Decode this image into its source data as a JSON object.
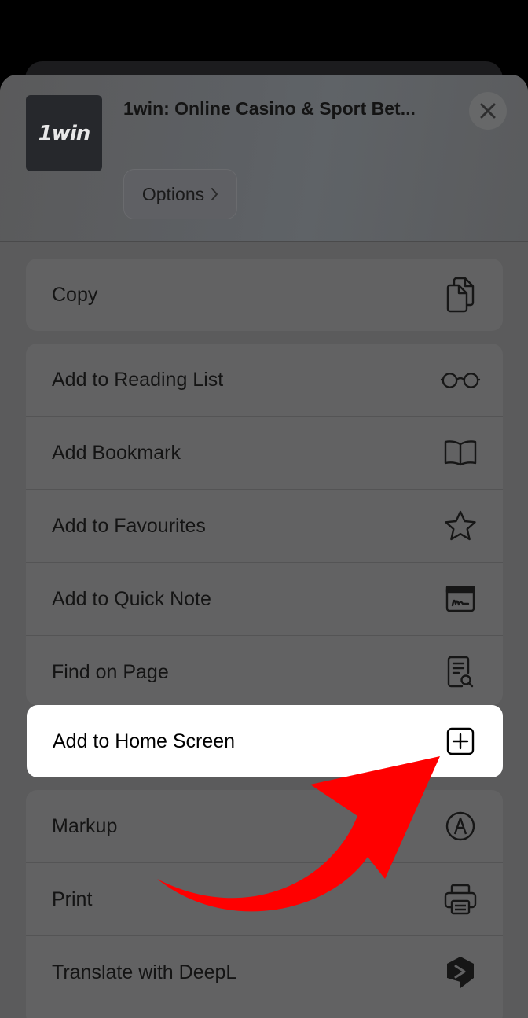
{
  "header": {
    "site_title": "1win: Online Casino & Sport Bet...",
    "app_icon_text": "1win",
    "options_label": "Options",
    "close_icon": "close-icon",
    "options_chevron_icon": "chevron-right-icon"
  },
  "group1": {
    "items": [
      {
        "label": "Copy",
        "icon": "copy-icon"
      }
    ]
  },
  "group2": {
    "items": [
      {
        "label": "Add to Reading List",
        "icon": "glasses-icon"
      },
      {
        "label": "Add Bookmark",
        "icon": "book-icon"
      },
      {
        "label": "Add to Favourites",
        "icon": "star-icon"
      },
      {
        "label": "Add to Quick Note",
        "icon": "quick-note-icon"
      },
      {
        "label": "Find on Page",
        "icon": "find-page-icon"
      }
    ]
  },
  "highlighted_item": {
    "label": "Add to Home Screen",
    "icon": "add-square-icon"
  },
  "group3": {
    "items": [
      {
        "label": "Markup",
        "icon": "markup-pen-icon"
      },
      {
        "label": "Print",
        "icon": "printer-icon"
      },
      {
        "label": "Translate with DeepL",
        "icon": "deepl-icon"
      }
    ]
  },
  "annotation": {
    "arrow_color": "#ff0000",
    "arrow_icon": "red-arrow-icon"
  },
  "colors": {
    "sheet_dim": "#5b5b5c",
    "row_bg": "#626263",
    "highlight_bg": "#ffffff"
  }
}
